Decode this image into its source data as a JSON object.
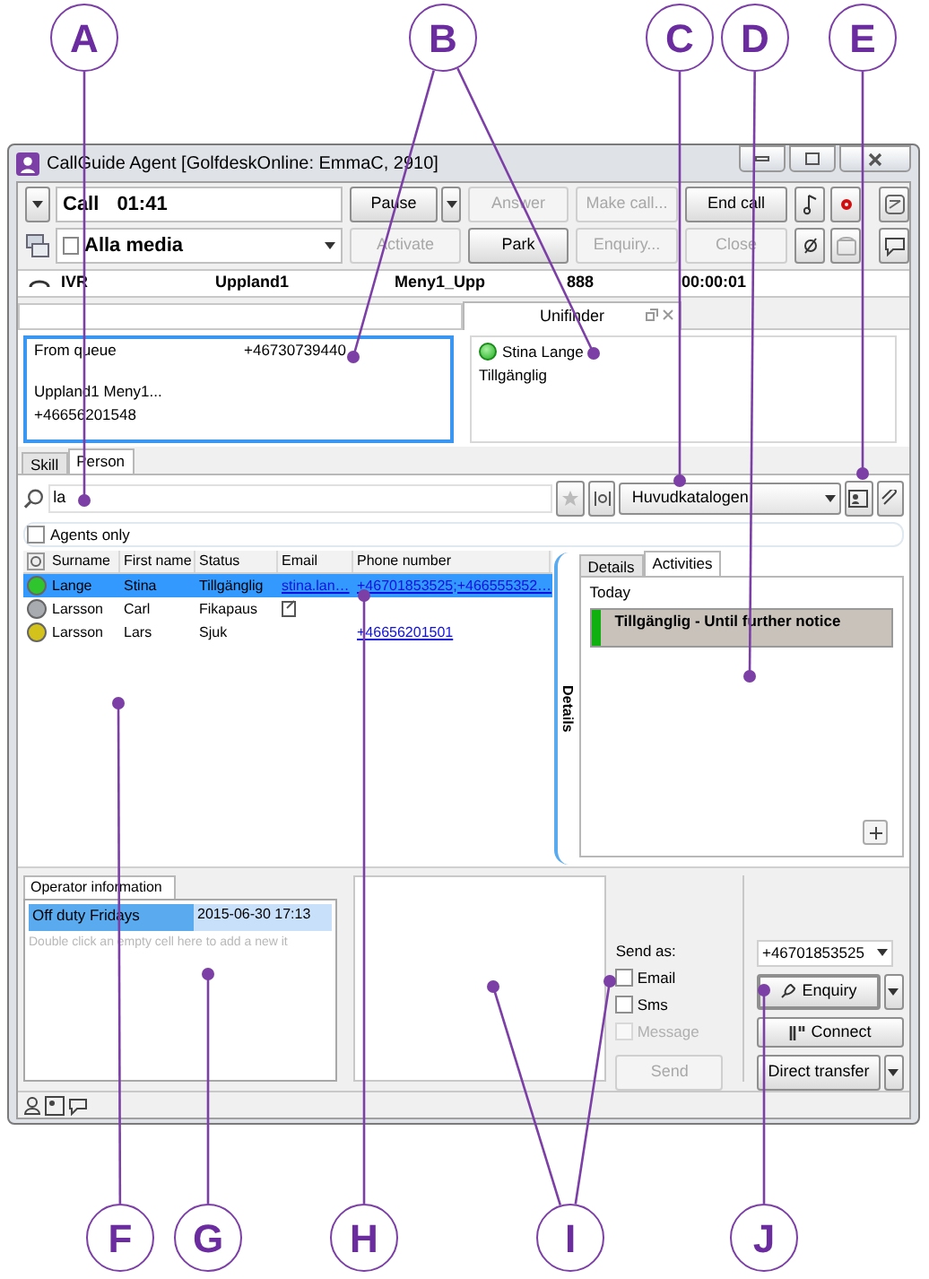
{
  "callouts": [
    {
      "label": "A"
    },
    {
      "label": "B"
    },
    {
      "label": "C"
    },
    {
      "label": "D"
    },
    {
      "label": "E"
    },
    {
      "label": "F"
    },
    {
      "label": "G"
    },
    {
      "label": "H"
    },
    {
      "label": "I"
    },
    {
      "label": "J"
    }
  ],
  "window": {
    "title": "CallGuide Agent [GolfdeskOnline: EmmaC, 2910]"
  },
  "toolbar": {
    "call_label": "Call",
    "timer": "01:41",
    "media": "Alla media",
    "row_1": [
      {
        "kind": "split",
        "label": "Pause",
        "disabled": false
      },
      {
        "kind": "button",
        "label": "Answer",
        "disabled": true
      },
      {
        "kind": "button",
        "label": "Make call...",
        "disabled": true
      },
      {
        "kind": "button",
        "label": "End call",
        "disabled": false
      }
    ],
    "row_2": [
      {
        "kind": "button",
        "label": "Activate",
        "disabled": true
      },
      {
        "kind": "button",
        "label": "Park",
        "disabled": false
      },
      {
        "kind": "button",
        "label": "Enquiry...",
        "disabled": true
      },
      {
        "kind": "button",
        "label": "Close",
        "disabled": true
      }
    ]
  },
  "call_info": [
    "IVR",
    "Uppland1",
    "Meny1_Upp",
    "888",
    "00:00:01"
  ],
  "workspace_tab": {
    "label": "Unifinder"
  },
  "queue_info": {
    "label": "From queue",
    "number": "+46730739440",
    "lines": [
      "Uppland1 Meny1...",
      "+46656201548"
    ]
  },
  "contact": {
    "name": "Stina Lange",
    "status": "Tillgänglig"
  },
  "tabs": [
    {
      "label": "Skill",
      "selected": false
    },
    {
      "label": "Person",
      "selected": true
    }
  ],
  "search": {
    "value": "la"
  },
  "directory": {
    "value": "Huvudkatalogen"
  },
  "agents_only": {
    "label": "Agents only",
    "checked": false
  },
  "table": {
    "columns": [
      "Surname",
      "First name",
      "Status",
      "Email",
      "Phone number"
    ],
    "rows": [
      {
        "surname": "Lange",
        "first_name": "Stina",
        "status": "Tillgänglig",
        "email": "stina.lan…",
        "email_note": false,
        "phone": "+46701853525;+466555352…",
        "color": "#2ec52e",
        "selected": true
      },
      {
        "surname": "Larsson",
        "first_name": "Carl",
        "status": "Fikapaus",
        "email_note": true,
        "color": "#a8acb0",
        "selected": false
      },
      {
        "surname": "Larsson",
        "first_name": "Lars",
        "status": "Sjuk",
        "email_note": false,
        "phone": "+46656201501",
        "color": "#d4c21c",
        "selected": false
      }
    ]
  },
  "details_strip": {
    "label": "Details"
  },
  "detail_tabs": [
    {
      "label": "Details",
      "selected": false
    },
    {
      "label": "Activities",
      "selected": true
    }
  ],
  "activities": {
    "day": "Today",
    "items": [
      {
        "text": "Tillgänglig - Until further notice",
        "color": "#10b010"
      }
    ]
  },
  "operator_info": {
    "tab": "Operator information",
    "rows": [
      {
        "title": "Off duty Fridays",
        "time": "2015-06-30 17:13",
        "selected": true
      }
    ],
    "hint": "Double click an empty cell here to add a new it"
  },
  "send": {
    "label": "Send as:",
    "options": [
      {
        "label": "Email",
        "checked": false,
        "disabled": false
      },
      {
        "label": "Sms",
        "checked": false,
        "disabled": false
      },
      {
        "label": "Message",
        "checked": false,
        "disabled": true
      }
    ],
    "button": {
      "label": "Send",
      "disabled": true
    }
  },
  "transfer": {
    "number": "+46701853525",
    "buttons": [
      {
        "kind": "split",
        "label": "Enquiry",
        "focused": true
      },
      {
        "kind": "button",
        "label": "Connect",
        "focused": false
      },
      {
        "kind": "split",
        "label": "Direct transfer",
        "focused": false
      }
    ]
  }
}
